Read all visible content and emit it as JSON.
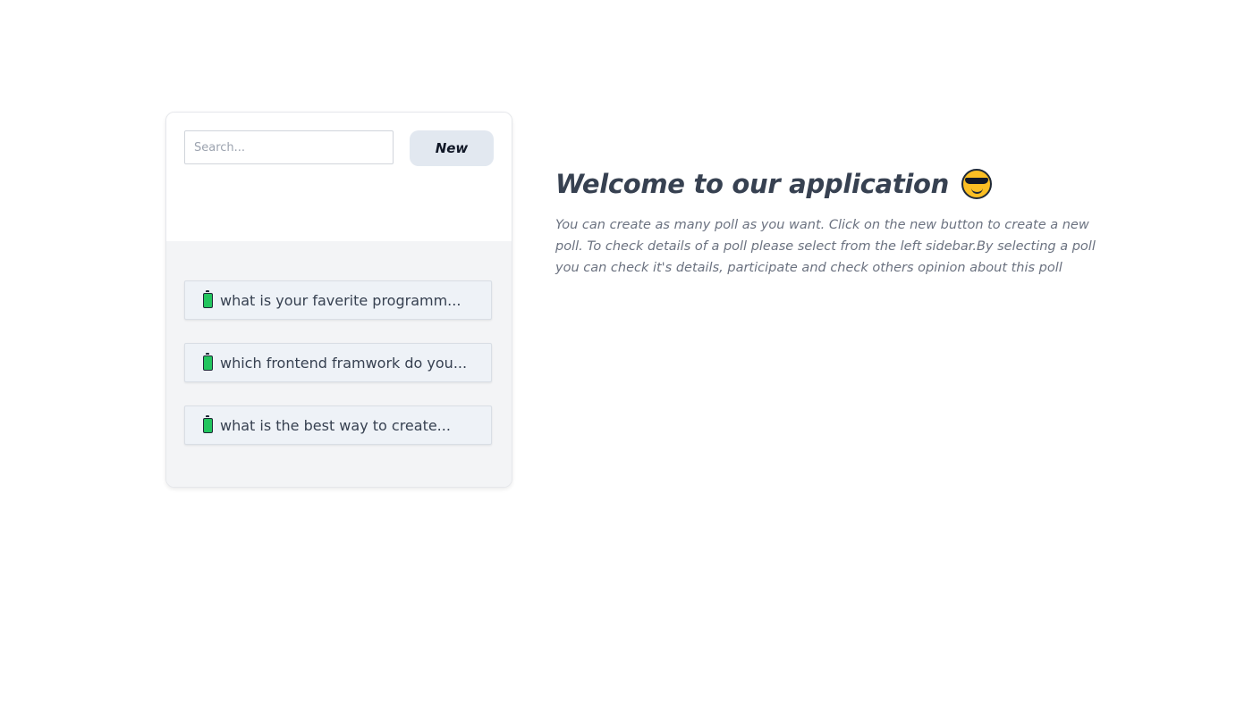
{
  "sidebar": {
    "search": {
      "placeholder": "Search...",
      "value": ""
    },
    "new_button_label": "New",
    "polls": [
      {
        "label": "what is your faverite programm...",
        "icon": "battery-icon"
      },
      {
        "label": "which frontend framwork do you...",
        "icon": "battery-icon"
      },
      {
        "label": "what is the best way to create...",
        "icon": "battery-icon"
      }
    ]
  },
  "main": {
    "title": "Welcome to our application",
    "title_icon": "cool-face-icon",
    "description": "You can create as many poll as you want. Click on the new button to create a new poll. To check details of a poll please select from the left sidebar.By selecting a poll you can check it's details, participate and check others opinion about this poll"
  },
  "colors": {
    "button_bg": "#e2e8f0",
    "list_bg": "#f3f4f6",
    "item_bg": "#eef2f7",
    "title_text": "#374151",
    "body_text": "#6b7280"
  }
}
